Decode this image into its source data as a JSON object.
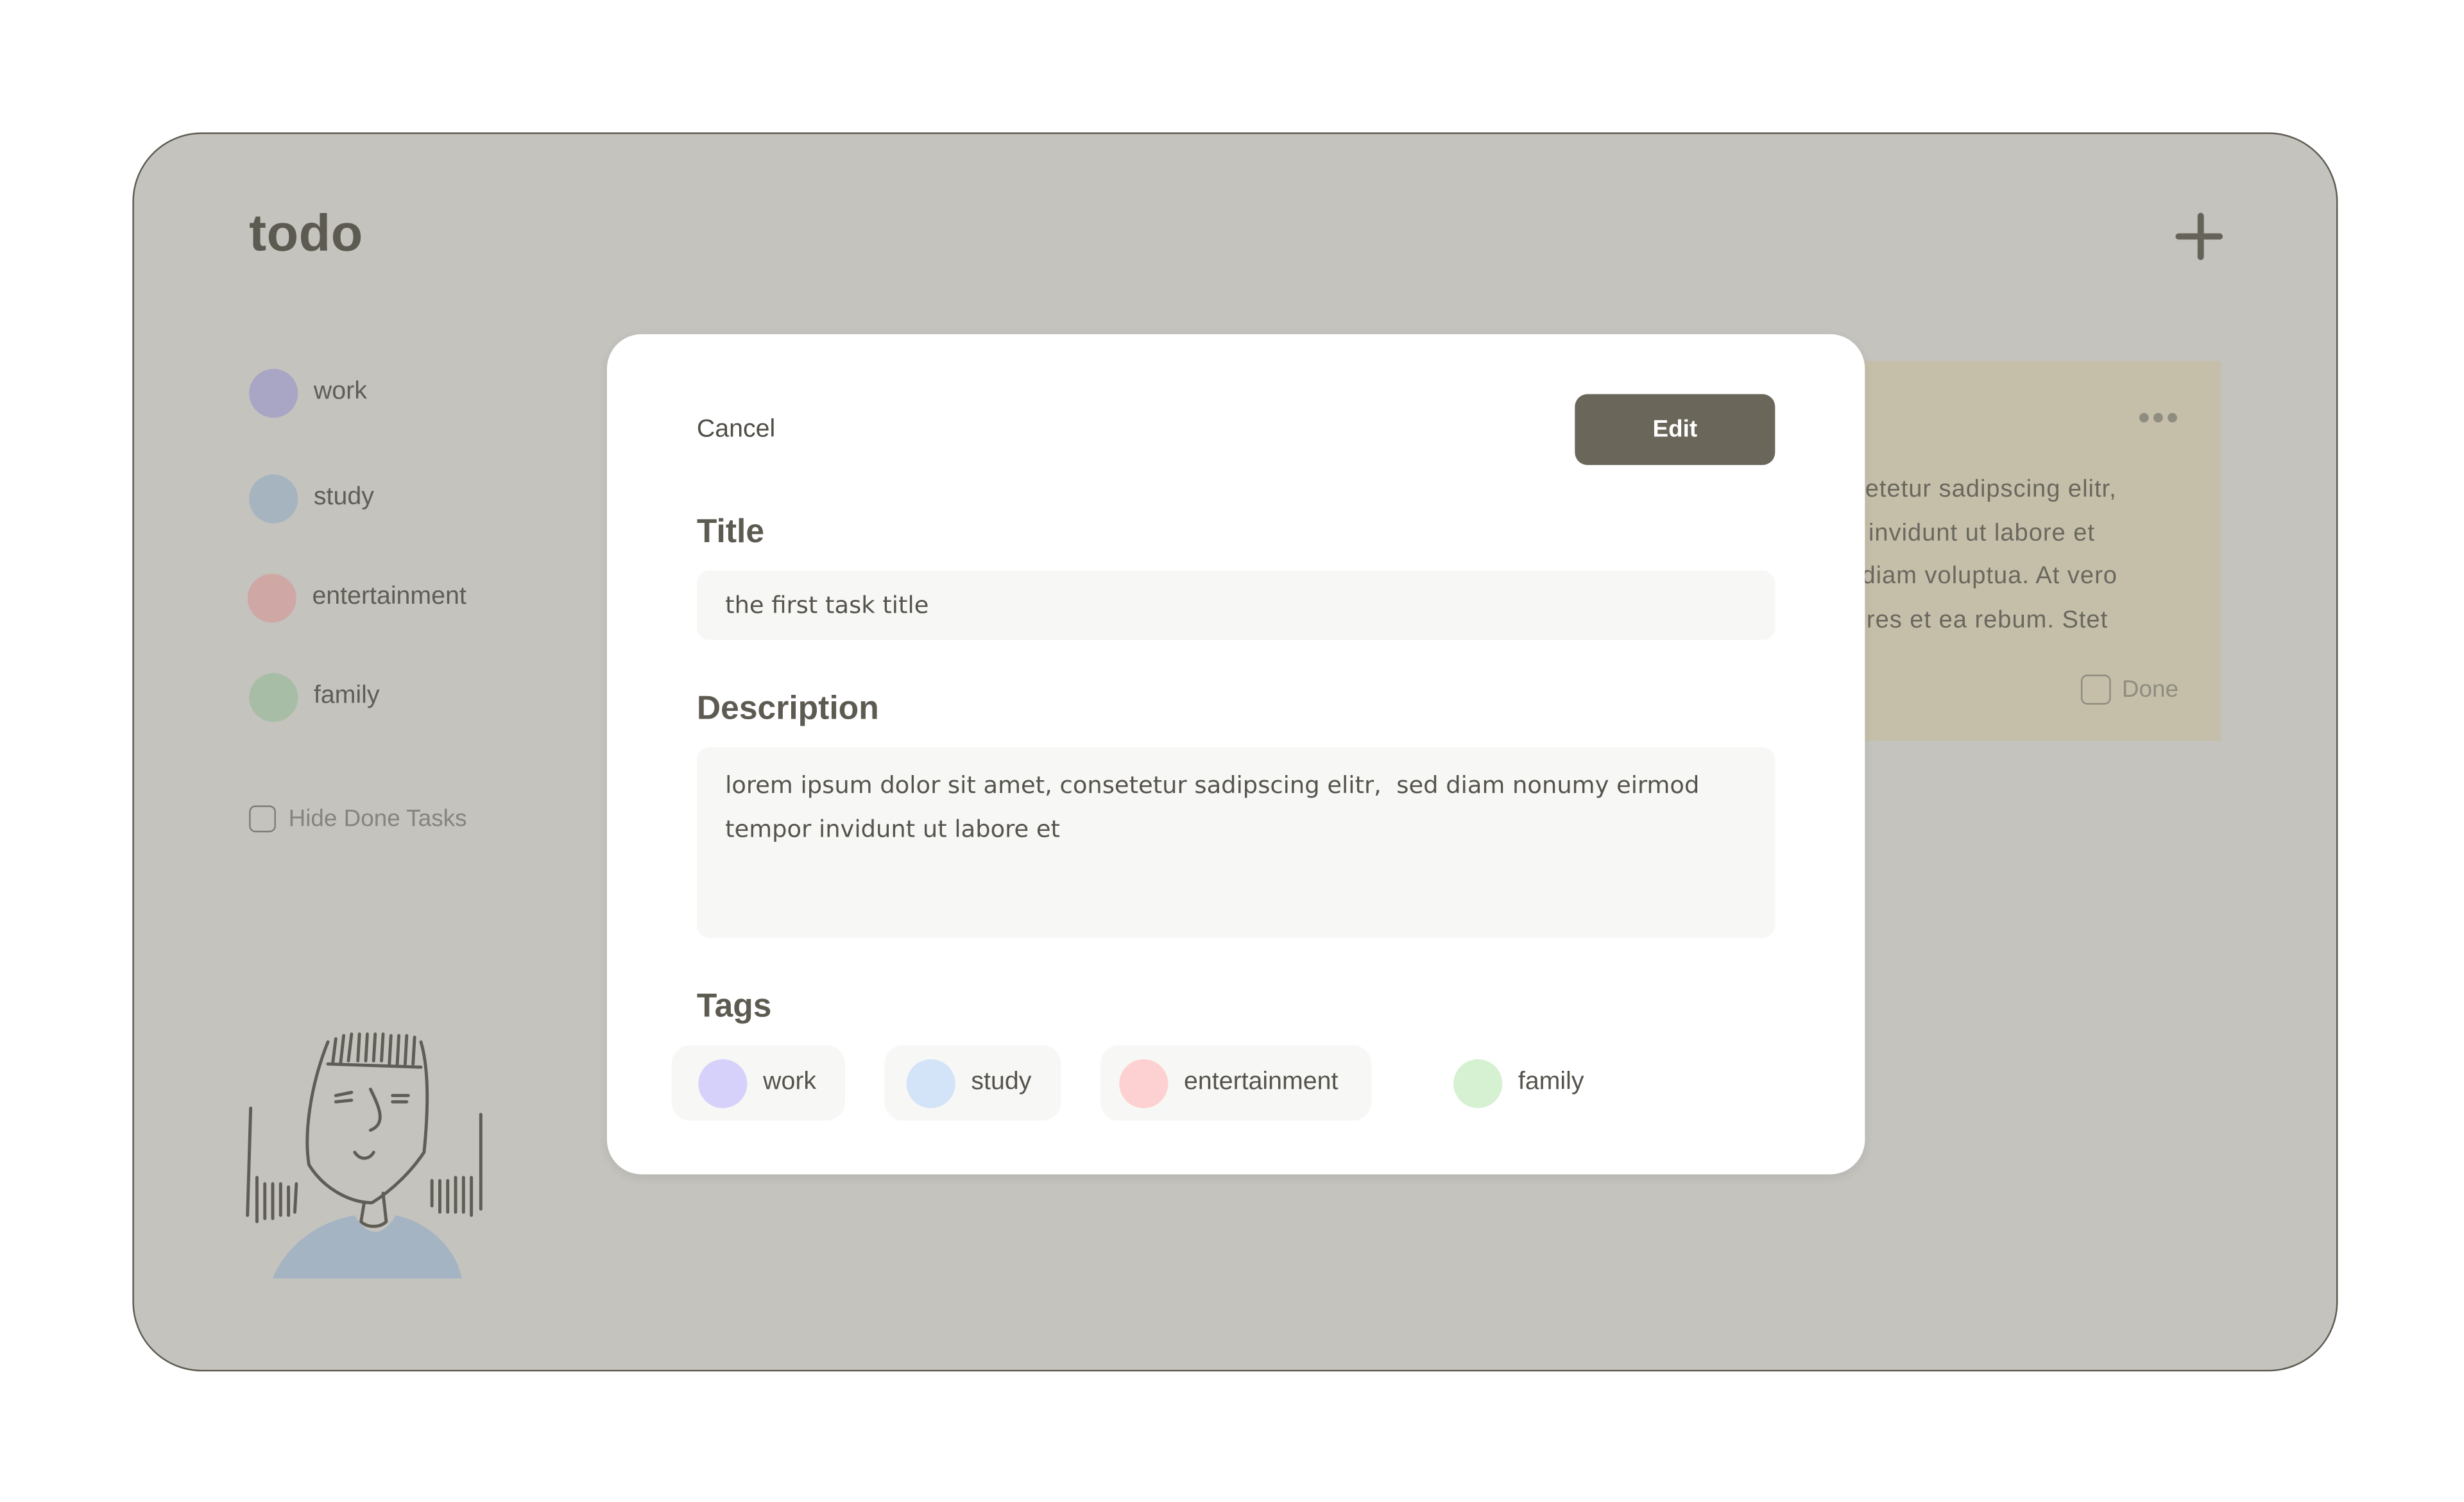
{
  "app": {
    "title": "todo",
    "add_icon": "plus-icon"
  },
  "sidebar": {
    "items": [
      {
        "label": "work",
        "color": "#a9a6c5"
      },
      {
        "label": "study",
        "color": "#a6b4c0"
      },
      {
        "label": "entertainment",
        "color": "#cfa8a6"
      },
      {
        "label": "family",
        "color": "#a8bda6"
      }
    ],
    "hide_done": {
      "label": "Hide Done Tasks",
      "checked": false
    }
  },
  "card": {
    "lines": [
      "setetur sadipscing elitr,",
      "r invidunt ut labore et",
      "diam voluptua. At vero",
      "ores et ea rebum. Stet"
    ],
    "menu_icon": "ellipsis-icon",
    "done_label": "Done",
    "background": "#c5bfaa"
  },
  "modal": {
    "cancel_label": "Cancel",
    "edit_label": "Edit",
    "title_label": "Title",
    "title_value": "the first task title",
    "description_label": "Description",
    "description_value": "lorem ipsum dolor sit amet, consetetur sadipscing elitr,  sed diam nonumy eirmod tempor invidunt ut labore et",
    "tags_label": "Tags",
    "tags": [
      {
        "label": "work",
        "color": "#d5d1fb"
      },
      {
        "label": "study",
        "color": "#d3e3f8"
      },
      {
        "label": "entertainment",
        "color": "#fdd1d1"
      },
      {
        "label": "family",
        "color": "#d6f1d2"
      }
    ]
  },
  "colors": {
    "backdrop": "#c4c3be",
    "accent": "#6a6659",
    "modal_background": "#ffffff",
    "field_background": "#f7f7f5"
  }
}
